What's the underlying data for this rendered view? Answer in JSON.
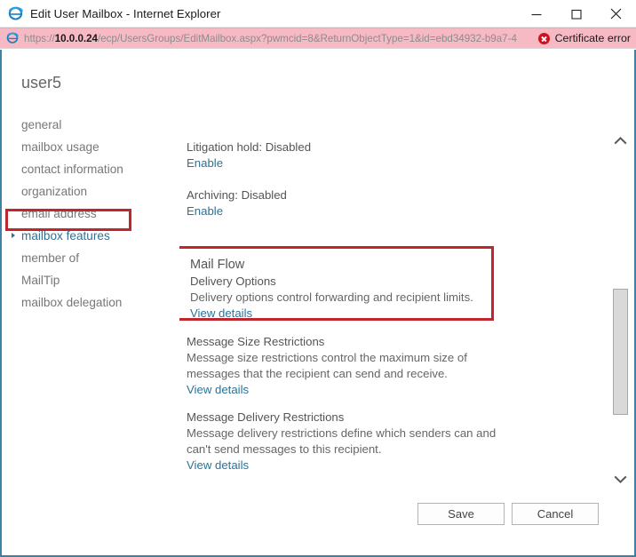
{
  "window": {
    "title": "Edit User Mailbox - Internet Explorer",
    "app_icon": "internet-explorer-icon",
    "controls": {
      "minimize": "Minimize",
      "maximize": "Maximize",
      "close": "Close"
    }
  },
  "address_bar": {
    "scheme": "https://",
    "host": "10.0.0.24",
    "path": "/ecp/UsersGroups/EditMailbox.aspx?pwmcid=8&ReturnObjectType=1&id=ebd34932-b9a7-4",
    "full_url": "https://10.0.0.24/ecp/UsersGroups/EditMailbox.aspx?pwmcid=8&ReturnObjectType=1&id=ebd34932-b9a7-4",
    "certificate_error": "Certificate error",
    "warning_color": "#f7b9c4"
  },
  "nav": {
    "title": "user5",
    "items": [
      {
        "label": "general",
        "selected": false
      },
      {
        "label": "mailbox usage",
        "selected": false
      },
      {
        "label": "contact information",
        "selected": false
      },
      {
        "label": "organization",
        "selected": false
      },
      {
        "label": "email address",
        "selected": false
      },
      {
        "label": "mailbox features",
        "selected": true
      },
      {
        "label": "member of",
        "selected": false
      },
      {
        "label": "MailTip",
        "selected": false
      },
      {
        "label": "mailbox delegation",
        "selected": false
      }
    ],
    "selected_index": 5,
    "highlight_color": "#c0272d",
    "selected_color": "#2a7399"
  },
  "content": {
    "litigation": {
      "status": "Litigation hold: Disabled",
      "link": "Enable"
    },
    "archiving": {
      "status": "Archiving: Disabled",
      "link": "Enable"
    },
    "mail_flow": {
      "title": "Mail Flow",
      "subtitle": "Delivery Options",
      "description": "Delivery options control forwarding and recipient limits.",
      "link": "View details",
      "highlighted": true
    },
    "message_size": {
      "title": "Message Size Restrictions",
      "description": "Message size restrictions control the maximum size of messages that the recipient can send and receive.",
      "link": "View details"
    },
    "message_delivery": {
      "title": "Message Delivery Restrictions",
      "description": "Message delivery restrictions define which senders can and can't send messages to this recipient.",
      "link": "View details"
    }
  },
  "scrollbar": {
    "up_arrow": "chevron-up-icon",
    "down_arrow": "chevron-down-icon"
  },
  "footer": {
    "save_label": "Save",
    "cancel_label": "Cancel"
  }
}
